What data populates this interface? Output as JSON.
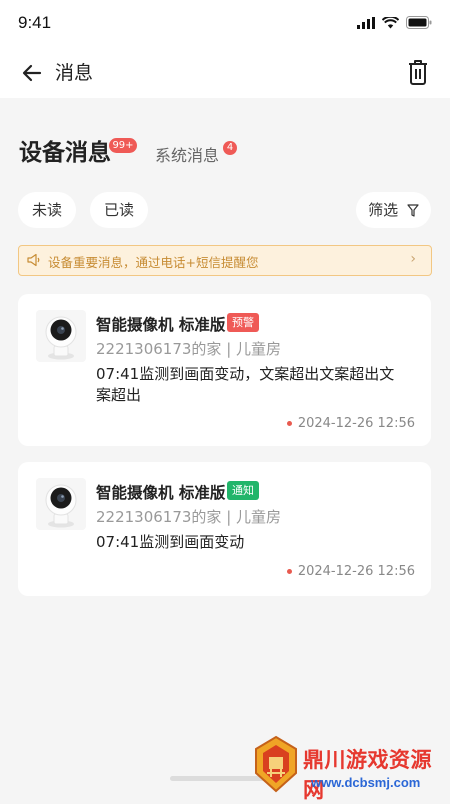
{
  "status_bar": {
    "time": "9:41"
  },
  "nav": {
    "title": "消息"
  },
  "tabs": {
    "device": {
      "label": "设备消息",
      "badge": "99+"
    },
    "system": {
      "label": "系统消息",
      "badge": "4"
    }
  },
  "filters": {
    "unread": "未读",
    "read": "已读",
    "filter": "筛选"
  },
  "notice": {
    "text": "设备重要消息，通过电话+短信提醒您"
  },
  "messages": [
    {
      "device": "智能摄像机 标准版",
      "tag": "预警",
      "location": "2221306173的家 | 儿童房",
      "desc": "07:41监测到画面变动，文案超出文案超出文案超出",
      "time": "2024-12-26 12:56"
    },
    {
      "device": "智能摄像机 标准版",
      "tag": "通知",
      "location": "2221306173的家 | 儿童房",
      "desc": "07:41监测到画面变动",
      "time": "2024-12-26 12:56"
    }
  ],
  "watermark": {
    "name": "鼎川游戏资源网",
    "url": "www.dcbsmj.com"
  },
  "colors": {
    "accent_red": "#ef5a56",
    "notice_green": "#22b56a",
    "notice_bar": "#fdf1dd"
  }
}
